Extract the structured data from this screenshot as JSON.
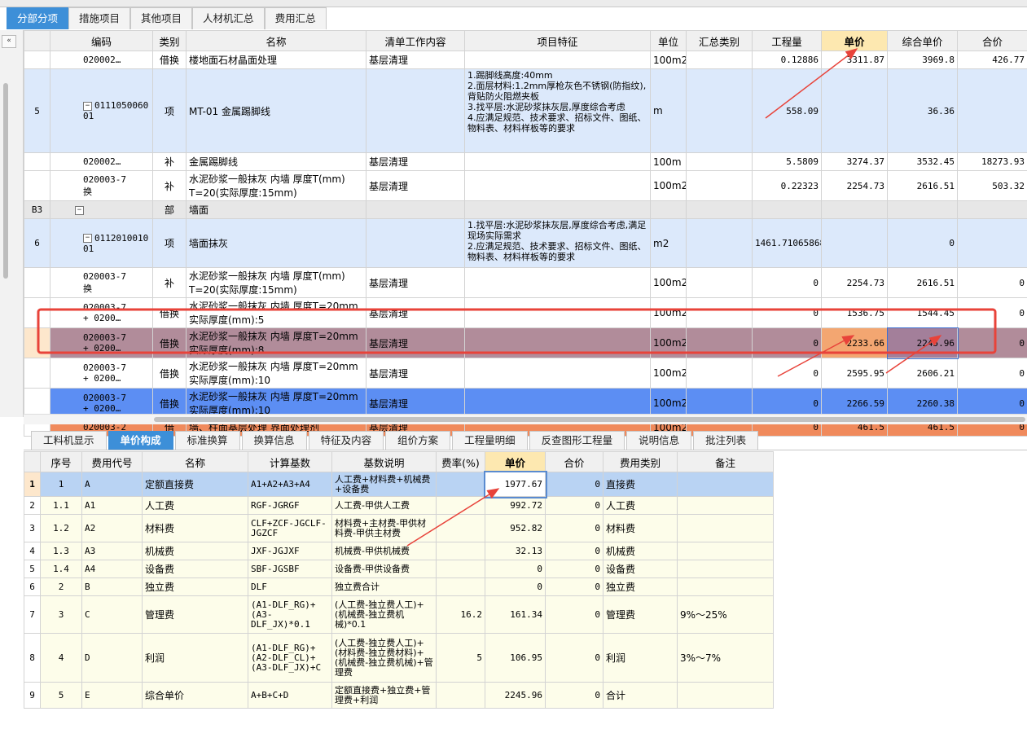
{
  "top_tabs": [
    "分部分项",
    "措施项目",
    "其他项目",
    "人材机汇总",
    "费用汇总"
  ],
  "collapse_icon": "«",
  "main": {
    "headers": [
      "编码",
      "类别",
      "名称",
      "清单工作内容",
      "项目特征",
      "单位",
      "汇总类别",
      "工程量",
      "单价",
      "综合单价",
      "合价"
    ],
    "rows": [
      {
        "no": "",
        "code": "020002…",
        "cat": "借换",
        "name": "楼地面石材晶面处理",
        "work": "基层清理",
        "feat": "",
        "unit": "100m2",
        "sum": "",
        "qty": "0.12886",
        "price": "3311.87",
        "cprice": "3969.8",
        "total": "426.77"
      },
      {
        "no": "5",
        "code": "0111050060\n01",
        "cat": "项",
        "name": "MT-01 金属踢脚线",
        "work": "",
        "feat": "1.踢脚线高度:40mm\n2.面层材料:1.2mm厚枪灰色不锈钢(防指纹),背贴防火阻燃夹板\n3.找平层:水泥砂浆抹灰层,厚度综合考虑\n4.应满足规范、技术要求、招标文件、图纸、物料表、材料样板等的要求",
        "unit": "m",
        "sum": "",
        "qty": "558.09",
        "price": "",
        "cprice": "36.36",
        "total": ""
      },
      {
        "no": "",
        "code": "020002…",
        "cat": "补",
        "name": "金属踢脚线",
        "work": "基层清理",
        "feat": "",
        "unit": "100m",
        "sum": "",
        "qty": "5.5809",
        "price": "3274.37",
        "cprice": "3532.45",
        "total": "18273.93"
      },
      {
        "no": "",
        "code": "020003-7\n换",
        "cat": "补",
        "name": "水泥砂浆一般抹灰 内墙 厚度T(mm)\nT=20(实际厚度:15mm)",
        "work": "基层清理",
        "feat": "",
        "unit": "100m2",
        "sum": "",
        "qty": "0.22323",
        "price": "2254.73",
        "cprice": "2616.51",
        "total": "503.32"
      },
      {
        "no": "B3",
        "code": "",
        "cat": "部",
        "name": "墙面",
        "work": "",
        "feat": "",
        "unit": "",
        "sum": "",
        "qty": "",
        "price": "",
        "cprice": "",
        "total": ""
      },
      {
        "no": "6",
        "code": "0112010010\n01",
        "cat": "项",
        "name": "墙面抹灰",
        "work": "",
        "feat": "1.找平层:水泥砂浆抹灰层,厚度综合考虑,满足现场实际需求\n2.应满足规范、技术要求、招标文件、图纸、物料表、材料样板等的要求",
        "unit": "m2",
        "sum": "",
        "qty": "1461.71065868",
        "price": "",
        "cprice": "0",
        "total": ""
      },
      {
        "no": "",
        "code": "020003-7\n换",
        "cat": "补",
        "name": "水泥砂浆一般抹灰 内墙 厚度T(mm)\nT=20(实际厚度:15mm)",
        "work": "基层清理",
        "feat": "",
        "unit": "100m2",
        "sum": "",
        "qty": "0",
        "price": "2254.73",
        "cprice": "2616.51",
        "total": "0"
      },
      {
        "no": "",
        "code": "020003-7\n+ 0200…",
        "cat": "借换",
        "name": "水泥砂浆一般抹灰 内墙 厚度T=20mm 实际厚度(mm):5",
        "work": "基层清理",
        "feat": "",
        "unit": "100m2",
        "sum": "",
        "qty": "0",
        "price": "1536.75",
        "cprice": "1544.45",
        "total": "0"
      },
      {
        "no": "",
        "code": "020003-7\n+ 0200…",
        "cat": "借换",
        "name": "水泥砂浆一般抹灰 内墙 厚度T=20mm 实际厚度(mm):8",
        "work": "基层清理",
        "feat": "",
        "unit": "100m2",
        "sum": "",
        "qty": "0",
        "price": "2233.66",
        "cprice": "2245.96",
        "total": "0"
      },
      {
        "no": "",
        "code": "020003-7\n+ 0200…",
        "cat": "借换",
        "name": "水泥砂浆一般抹灰 内墙 厚度T=20mm 实际厚度(mm):10",
        "work": "基层清理",
        "feat": "",
        "unit": "100m2",
        "sum": "",
        "qty": "0",
        "price": "2595.95",
        "cprice": "2606.21",
        "total": "0"
      },
      {
        "no": "",
        "code": "020003-7\n+ 0200…",
        "cat": "借换",
        "name": "水泥砂浆一般抹灰 内墙 厚度T=20mm 实际厚度(mm):10",
        "work": "基层清理",
        "feat": "",
        "unit": "100m2",
        "sum": "",
        "qty": "0",
        "price": "2266.59",
        "cprice": "2260.38",
        "total": "0"
      },
      {
        "no": "",
        "code": "020003-2",
        "cat": "借",
        "name": "墙、柱面基层处理 界面处理剂",
        "work": "基层清理",
        "feat": "",
        "unit": "100m2",
        "sum": "",
        "qty": "0",
        "price": "461.5",
        "cprice": "461.5",
        "total": "0"
      }
    ]
  },
  "bottom_tabs": [
    "工料机显示",
    "单价构成",
    "标准换算",
    "换算信息",
    "特征及内容",
    "组价方案",
    "工程量明细",
    "反查图形工程量",
    "说明信息",
    "批注列表"
  ],
  "sub": {
    "headers": [
      "",
      "序号",
      "费用代号",
      "名称",
      "计算基数",
      "基数说明",
      "费率(%)",
      "单价",
      "合价",
      "费用类别",
      "备注"
    ],
    "rows": [
      {
        "r": "1",
        "seq": "1",
        "code": "A",
        "name": "定额直接费",
        "base": "A1+A2+A3+A4",
        "desc": "人工费+材料费+机械费+设备费",
        "rate": "",
        "price": "1977.67",
        "total": "0",
        "type": "直接费",
        "note": ""
      },
      {
        "r": "2",
        "seq": "1.1",
        "code": "A1",
        "name": "人工费",
        "base": "RGF-JGRGF",
        "desc": "人工费-甲供人工费",
        "rate": "",
        "price": "992.72",
        "total": "0",
        "type": "人工费",
        "note": ""
      },
      {
        "r": "3",
        "seq": "1.2",
        "code": "A2",
        "name": "材料费",
        "base": "CLF+ZCF-JGCLF-JGZCF",
        "desc": "材料费+主材费-甲供材料费-甲供主材费",
        "rate": "",
        "price": "952.82",
        "total": "0",
        "type": "材料费",
        "note": ""
      },
      {
        "r": "4",
        "seq": "1.3",
        "code": "A3",
        "name": "机械费",
        "base": "JXF-JGJXF",
        "desc": "机械费-甲供机械费",
        "rate": "",
        "price": "32.13",
        "total": "0",
        "type": "机械费",
        "note": ""
      },
      {
        "r": "5",
        "seq": "1.4",
        "code": "A4",
        "name": "设备费",
        "base": "SBF-JGSBF",
        "desc": "设备费-甲供设备费",
        "rate": "",
        "price": "0",
        "total": "0",
        "type": "设备费",
        "note": ""
      },
      {
        "r": "6",
        "seq": "2",
        "code": "B",
        "name": "独立费",
        "base": "DLF",
        "desc": "独立费合计",
        "rate": "",
        "price": "0",
        "total": "0",
        "type": "独立费",
        "note": ""
      },
      {
        "r": "7",
        "seq": "3",
        "code": "C",
        "name": "管理费",
        "base": "(A1-DLF_RG)+(A3-DLF_JX)*0.1",
        "desc": "(人工费-独立费人工)+(机械费-独立费机械)*0.1",
        "rate": "16.2",
        "price": "161.34",
        "total": "0",
        "type": "管理费",
        "note": "9%～25%"
      },
      {
        "r": "8",
        "seq": "4",
        "code": "D",
        "name": "利润",
        "base": "(A1-DLF_RG)+(A2-DLF_CL)+(A3-DLF_JX)+C",
        "desc": "(人工费-独立费人工)+(材料费-独立费材料)+(机械费-独立费机械)+管理费",
        "rate": "5",
        "price": "106.95",
        "total": "0",
        "type": "利润",
        "note": "3%～7%"
      },
      {
        "r": "9",
        "seq": "5",
        "code": "E",
        "name": "综合单价",
        "base": "A+B+C+D",
        "desc": "定额直接费+独立费+管理费+利润",
        "rate": "",
        "price": "2245.96",
        "total": "0",
        "type": "合计",
        "note": ""
      }
    ]
  },
  "colors": {
    "tab_active": "#3d8fd8",
    "selected_row": "#b18c9a",
    "annotation": "#e8433a"
  }
}
